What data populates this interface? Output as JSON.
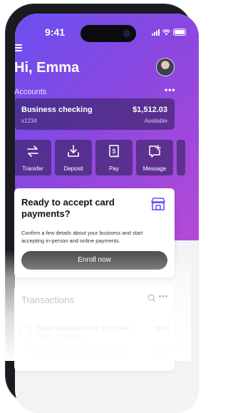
{
  "status_bar": {
    "time": "9:41"
  },
  "header": {
    "greeting": "Hi, Emma"
  },
  "accounts": {
    "label": "Accounts",
    "more": "•••",
    "card": {
      "name": "Business checking",
      "number": "x1234",
      "balance": "$1,512.03",
      "balance_label": "Available"
    }
  },
  "actions": [
    {
      "label": "Transfer",
      "icon": "transfer-icon"
    },
    {
      "label": "Deposit",
      "icon": "deposit-icon"
    },
    {
      "label": "Pay",
      "icon": "pay-icon"
    },
    {
      "label": "Message",
      "icon": "message-icon"
    }
  ],
  "promo": {
    "title": "Ready to accept card payments?",
    "text": "Confirm a few details about your business and start accepting in-person and online payments.",
    "button": "Enroll now",
    "icon": "store-icon"
  },
  "transactions": {
    "title": "Transactions",
    "more": "•••",
    "items": [
      {
        "name": "SOHO SUSHI BAR/THE ST CEDAR...",
        "amount": "$3.50",
        "status": "Pending",
        "account": "CHECKING"
      },
      {
        "name": "WHOLE FOODS MARKET CHICA...",
        "amount": "$28.70",
        "status": "",
        "account": ""
      }
    ]
  },
  "colors": {
    "gradient_start": "#6b4ff0",
    "gradient_end": "#b44ad6",
    "button_dark": "#2a2a2a"
  }
}
